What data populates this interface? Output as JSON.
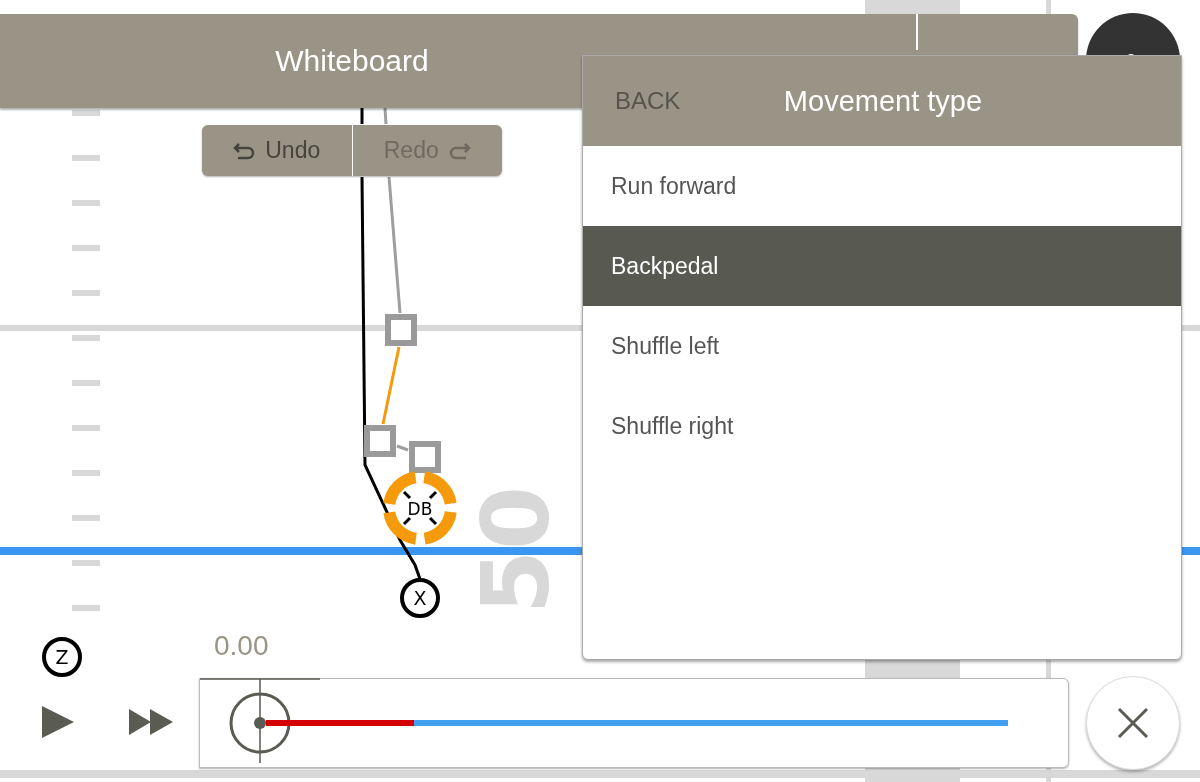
{
  "header": {
    "title": "Whiteboard"
  },
  "history": [
    {
      "kind": "undo",
      "label": "Undo",
      "disabled": false
    },
    {
      "kind": "redo",
      "label": "Redo",
      "disabled": true
    }
  ],
  "field": {
    "yard_number": "50",
    "players": [
      {
        "label": "DB",
        "kind": "defender"
      },
      {
        "label": "X",
        "kind": "receiver"
      },
      {
        "label": "Z",
        "kind": "receiver"
      }
    ]
  },
  "panel": {
    "back": "BACK",
    "title": "Movement type",
    "items": [
      {
        "label": "Run forward",
        "selected": false
      },
      {
        "label": "Backpedal",
        "selected": true
      },
      {
        "label": "Shuffle left",
        "selected": false
      },
      {
        "label": "Shuffle right",
        "selected": false
      }
    ]
  },
  "timeline": {
    "time": "0.00",
    "level": 0.2
  }
}
